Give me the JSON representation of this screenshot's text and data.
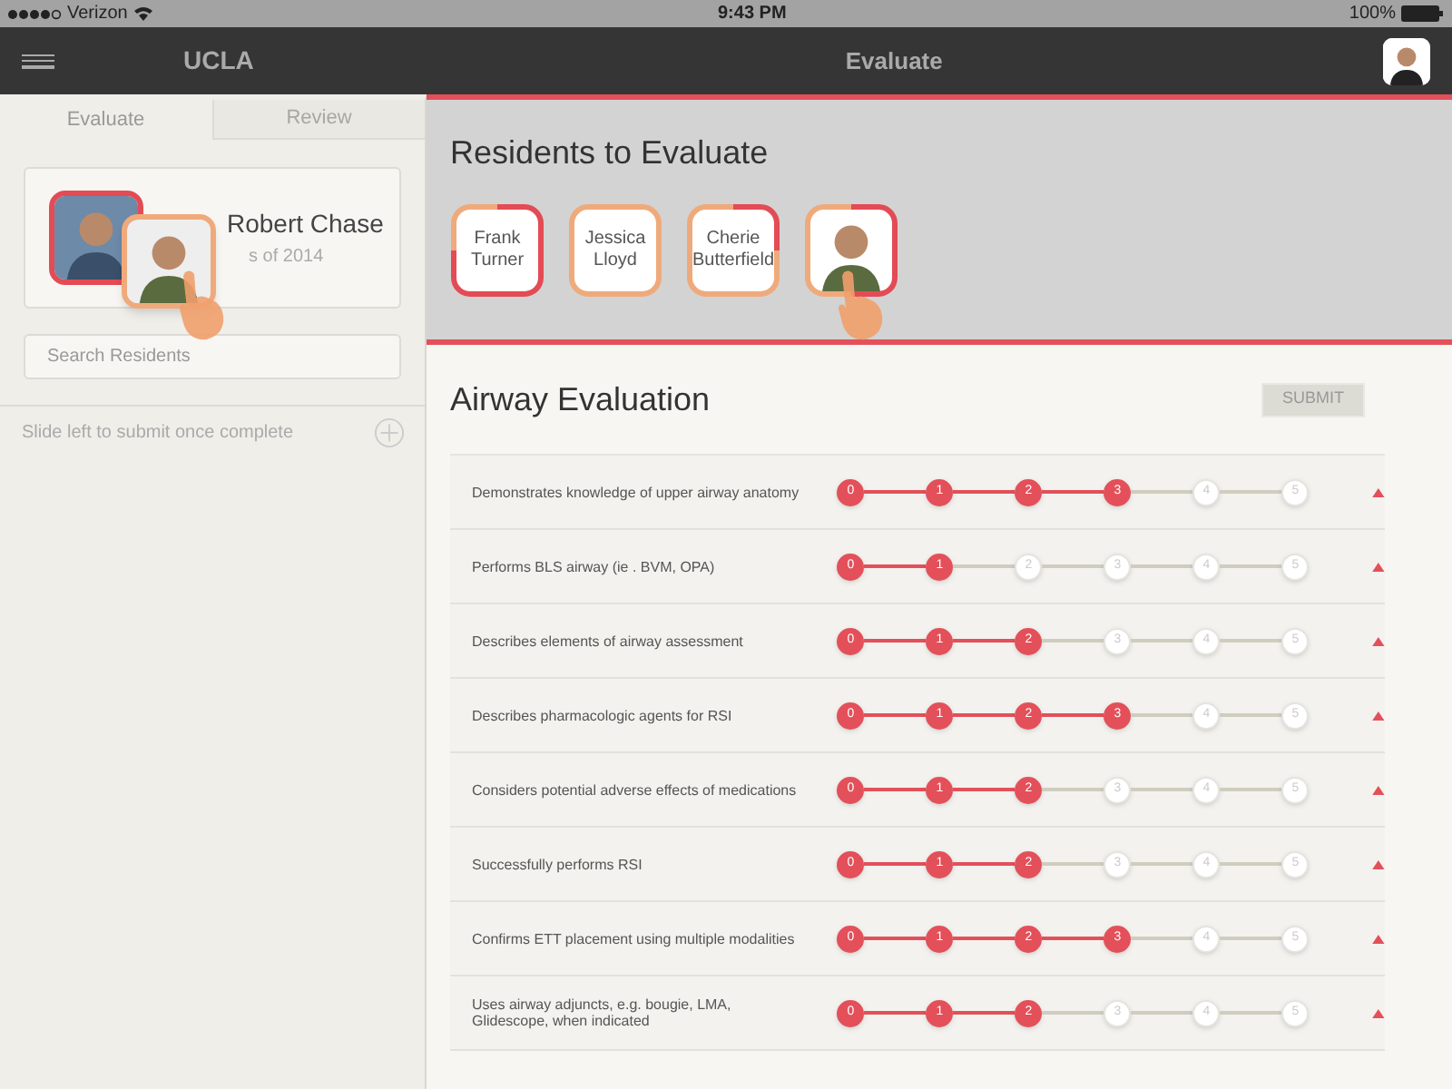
{
  "status_bar": {
    "carrier": "Verizon",
    "time": "9:43 PM",
    "battery": "100%"
  },
  "nav": {
    "brand": "UCLA",
    "title": "Evaluate"
  },
  "sidebar": {
    "tabs": [
      {
        "label": "Evaluate",
        "selected": true
      },
      {
        "label": "Review",
        "selected": false
      }
    ],
    "resident": {
      "name": "Robert Chase",
      "subtitle": "s of 2014"
    },
    "search": {
      "placeholder": "Search Residents"
    },
    "hint": "Slide left to submit once complete"
  },
  "residents_panel": {
    "title": "Residents to Evaluate",
    "residents": [
      {
        "kind": "name",
        "name": "Frank Turner",
        "segments": [
          {
            "filled": true
          },
          {
            "filled": true
          },
          {
            "filled": true
          },
          {
            "filled": false
          }
        ]
      },
      {
        "kind": "name",
        "name": "Jessica Lloyd",
        "segments": [
          {
            "filled": false
          },
          {
            "filled": false
          },
          {
            "filled": false
          },
          {
            "filled": false
          }
        ]
      },
      {
        "kind": "name",
        "name": "Cherie Butterfield",
        "segments": [
          {
            "filled": true
          },
          {
            "filled": false
          },
          {
            "filled": false
          },
          {
            "filled": false
          }
        ]
      },
      {
        "kind": "picture",
        "segments": [
          {
            "filled": true
          },
          {
            "filled": true
          },
          {
            "filled": false
          },
          {
            "filled": false
          }
        ]
      }
    ]
  },
  "evaluation": {
    "title": "Airway Evaluation",
    "submit": {
      "label": "SUBMIT",
      "disabled": true
    },
    "criteria": [
      {
        "label": "Demonstrates knowledge of upper airway anatomy",
        "steps": [
          {
            "label": "0",
            "filled": true
          },
          {
            "label": "1",
            "filled": true
          },
          {
            "label": "2",
            "filled": true
          },
          {
            "label": "3",
            "filled": true
          },
          {
            "label": "4",
            "filled": false
          },
          {
            "label": "5",
            "filled": false
          }
        ]
      },
      {
        "label": "Performs BLS airway (ie . BVM, OPA)",
        "steps": [
          {
            "label": "0",
            "filled": true
          },
          {
            "label": "1",
            "filled": true
          },
          {
            "label": "2",
            "filled": false
          },
          {
            "label": "3",
            "filled": false
          },
          {
            "label": "4",
            "filled": false
          },
          {
            "label": "5",
            "filled": false
          }
        ]
      },
      {
        "label": "Describes elements of airway assessment",
        "steps": [
          {
            "label": "0",
            "filled": true
          },
          {
            "label": "1",
            "filled": true
          },
          {
            "label": "2",
            "filled": true
          },
          {
            "label": "3",
            "filled": false
          },
          {
            "label": "4",
            "filled": false
          },
          {
            "label": "5",
            "filled": false
          }
        ]
      },
      {
        "label": "Describes pharmacologic agents for RSI",
        "steps": [
          {
            "label": "0",
            "filled": true
          },
          {
            "label": "1",
            "filled": true
          },
          {
            "label": "2",
            "filled": true
          },
          {
            "label": "3",
            "filled": true
          },
          {
            "label": "4",
            "filled": false
          },
          {
            "label": "5",
            "filled": false
          }
        ]
      },
      {
        "label": "Considers potential adverse effects of medications",
        "steps": [
          {
            "label": "0",
            "filled": true
          },
          {
            "label": "1",
            "filled": true
          },
          {
            "label": "2",
            "filled": true
          },
          {
            "label": "3",
            "filled": false
          },
          {
            "label": "4",
            "filled": false
          },
          {
            "label": "5",
            "filled": false
          }
        ]
      },
      {
        "label": "Successfully performs RSI",
        "steps": [
          {
            "label": "0",
            "filled": true
          },
          {
            "label": "1",
            "filled": true
          },
          {
            "label": "2",
            "filled": true
          },
          {
            "label": "3",
            "filled": false
          },
          {
            "label": "4",
            "filled": false
          },
          {
            "label": "5",
            "filled": false
          }
        ]
      },
      {
        "label": "Confirms ETT placement using multiple modalities",
        "steps": [
          {
            "label": "0",
            "filled": true
          },
          {
            "label": "1",
            "filled": true
          },
          {
            "label": "2",
            "filled": true
          },
          {
            "label": "3",
            "filled": true
          },
          {
            "label": "4",
            "filled": false
          },
          {
            "label": "5",
            "filled": false
          }
        ]
      },
      {
        "label": "Uses airway adjuncts, e.g. bougie, LMA, Glidescope, when indicated",
        "steps": [
          {
            "label": "0",
            "filled": true
          },
          {
            "label": "1",
            "filled": true
          },
          {
            "label": "2",
            "filled": true
          },
          {
            "label": "3",
            "filled": false
          },
          {
            "label": "4",
            "filled": false
          },
          {
            "label": "5",
            "filled": false
          }
        ]
      }
    ]
  }
}
